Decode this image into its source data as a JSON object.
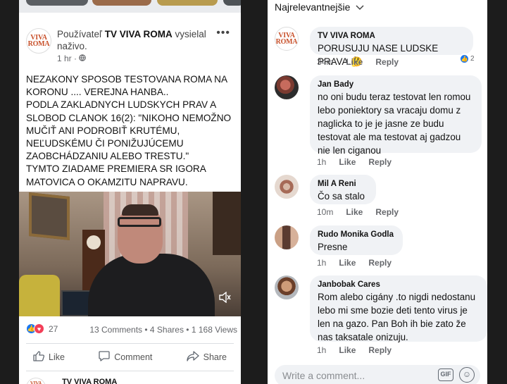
{
  "post": {
    "page_name": "TV VIVA ROMA",
    "author_prefix": "Používateľ",
    "author_suffix": "vysielal naživo.",
    "time": "1 hr",
    "privacy_icon": "globe-icon",
    "text": "NEZAKONY SPOSOB TESTOVANA  ROMA  NA KORONU .... VEREJNA HANBA..\nPODLA  ZAKLADNYCH LUDSKYCH PRAV A SLOBOD CLANOK 16(2): \"NIKOHO NEMOŽNO MUČIŤ ANI PODROBIŤ KRUTÉMU, NEĽUDSKÉMU ČI PONIŽUJÚCEMU ZAOBCHÁDZANIU ALEBO TRESTU.\"\nTYMTO ZIADAME PREMIERA SR IGORA MATOVICA O OKAMZITU NAPRAVU.",
    "logo_text": "VIVA\nROMA",
    "reactions_count": "27",
    "comments": "13 Comments",
    "shares": "4 Shares",
    "views": "1 168 Views",
    "actions": {
      "like": "Like",
      "comment": "Comment",
      "share": "Share"
    },
    "next_post_name": "TV VIVA ROMA"
  },
  "comments_panel": {
    "sort_label": "Najrelevantnejšie",
    "comments": [
      {
        "name": "TV VIVA ROMA",
        "text": "PORUSUJU NASE LUDSKE PRAVA.",
        "emoji": "🤔",
        "time": "34m",
        "like": "Like",
        "reply": "Reply",
        "likes": "2"
      },
      {
        "name": "Jan Bady",
        "text": "no oni budu teraz testovat len romou lebo poniektory sa vracaju domu z naglicka to je je jasne ze budu testovat ale ma testovat aj gadzou nie len ciganou",
        "time": "1h",
        "like": "Like",
        "reply": "Reply"
      },
      {
        "name": "Mil A Reni",
        "text": "Čo sa stalo",
        "time": "10m",
        "like": "Like",
        "reply": "Reply"
      },
      {
        "name": "Rudo Monika Godla",
        "text": "Presne",
        "time": "1h",
        "like": "Like",
        "reply": "Reply"
      },
      {
        "name": "Janbobak Cares",
        "text": "Rom alebo cigány .to nigdi nedostanu lebo mi sme bozie deti tento virus je len na gazo. Pan Boh ih bie zato že nas taksatale onizuju.",
        "time": "1h",
        "like": "Like",
        "reply": "Reply"
      }
    ],
    "composer_placeholder": "Write a comment...",
    "gif_label": "GIF"
  },
  "colors": {
    "accent": "#1877f2",
    "love": "#f33e58",
    "meta_text": "#65676b",
    "bubble": "#f0f2f5"
  }
}
